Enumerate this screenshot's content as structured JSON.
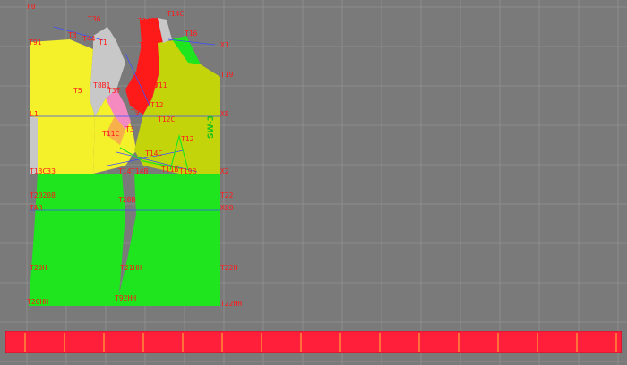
{
  "colors": {
    "background": "#7a7a7a",
    "grid": "#8c8c8c",
    "yellow": "#f4f02a",
    "green": "#1ee51e",
    "olive": "#c4d40a",
    "red": "#ff1a1a",
    "pink": "#f48ac0",
    "light_grey": "#c8c8c8",
    "label_red": "#ff1a1a",
    "line_blue": "#3b4fff",
    "ruler": "#ff1f3a"
  },
  "canvas": {
    "origin_label": "F0",
    "vertical_text": "SW-3"
  },
  "labels": [
    {
      "id": "f0",
      "text": "F0"
    },
    {
      "id": "t36",
      "text": "T36"
    },
    {
      "id": "t14c",
      "text": "T14C"
    },
    {
      "id": "t14b",
      "text": "T14B"
    },
    {
      "id": "t3",
      "text": "T3"
    },
    {
      "id": "t44",
      "text": "T44"
    },
    {
      "id": "t1",
      "text": "T1"
    },
    {
      "id": "t16",
      "text": "T16"
    },
    {
      "id": "t18",
      "text": "T18"
    },
    {
      "id": "x1",
      "text": "X1"
    },
    {
      "id": "t91",
      "text": "T91"
    },
    {
      "id": "t19",
      "text": "T19"
    },
    {
      "id": "t5",
      "text": "T5"
    },
    {
      "id": "t8b",
      "text": "T8B1"
    },
    {
      "id": "t3t",
      "text": "T3T"
    },
    {
      "id": "t10",
      "text": "T10"
    },
    {
      "id": "t11",
      "text": "T11"
    },
    {
      "id": "t12",
      "text": "T12"
    },
    {
      "id": "l1",
      "text": "L1"
    },
    {
      "id": "t9",
      "text": "T9"
    },
    {
      "id": "t12c",
      "text": "T12C"
    },
    {
      "id": "x8",
      "text": "X8"
    },
    {
      "id": "t11c",
      "text": "T11C"
    },
    {
      "id": "t3b",
      "text": "T3"
    },
    {
      "id": "t12r",
      "text": "T12"
    },
    {
      "id": "t14cb",
      "text": "T14C"
    },
    {
      "id": "t13c33",
      "text": "T13C33"
    },
    {
      "id": "t14",
      "text": "T14"
    },
    {
      "id": "t14b2",
      "text": "T14B"
    },
    {
      "id": "t11b",
      "text": "T11B"
    },
    {
      "id": "t19b",
      "text": "T19B"
    },
    {
      "id": "x2",
      "text": "X2"
    },
    {
      "id": "t20208",
      "text": "T20208"
    },
    {
      "id": "t20b",
      "text": "T20B"
    },
    {
      "id": "t22",
      "text": "T22"
    },
    {
      "id": "tar",
      "text": "TAR"
    },
    {
      "id": "x00",
      "text": "X00"
    },
    {
      "id": "t20h",
      "text": "T20H"
    },
    {
      "id": "t21hh",
      "text": "T21HH"
    },
    {
      "id": "t22h",
      "text": "T22H"
    },
    {
      "id": "t20hh",
      "text": "T20HH"
    },
    {
      "id": "t92hh",
      "text": "T92HH"
    },
    {
      "id": "t22hh",
      "text": "T22HH"
    }
  ]
}
